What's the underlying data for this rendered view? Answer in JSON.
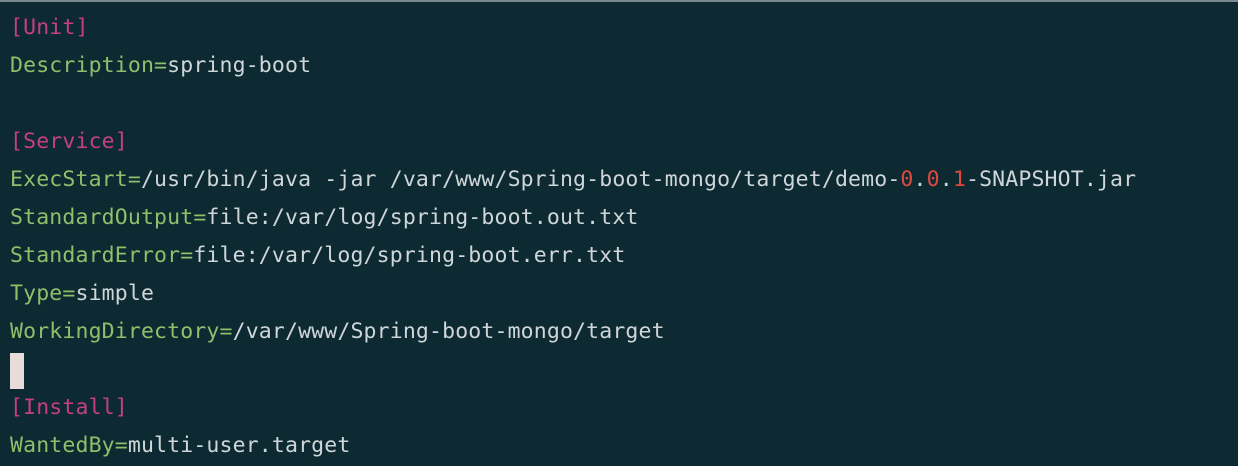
{
  "colors": {
    "background": "#0d2a33",
    "section": "#c63f7e",
    "key": "#8fbf6a",
    "value": "#cfd6d8",
    "number": "#e0483e",
    "cursor": "#e8dcd8"
  },
  "lines": {
    "unit_header": "[Unit]",
    "description": {
      "key": "Description=",
      "value": "spring-boot"
    },
    "service_header": "[Service]",
    "exec_start": {
      "key": "ExecStart=",
      "value_prefix": "/usr/bin/java -jar /var/www/Spring-boot-mongo/target/demo-",
      "version_major": "0",
      "dot1": ".",
      "version_minor": "0",
      "dot2": ".",
      "version_patch": "1",
      "value_suffix": "-SNAPSHOT.jar"
    },
    "standard_output": {
      "key": "StandardOutput=",
      "value": "file:/var/log/spring-boot.out.txt"
    },
    "standard_error": {
      "key": "StandardError=",
      "value": "file:/var/log/spring-boot.err.txt"
    },
    "type": {
      "key": "Type=",
      "value": "simple"
    },
    "working_directory": {
      "key": "WorkingDirectory=",
      "value": "/var/www/Spring-boot-mongo/target"
    },
    "install_header": "[Install]",
    "wanted_by": {
      "key": "WantedBy=",
      "value": "multi-user.target"
    }
  }
}
